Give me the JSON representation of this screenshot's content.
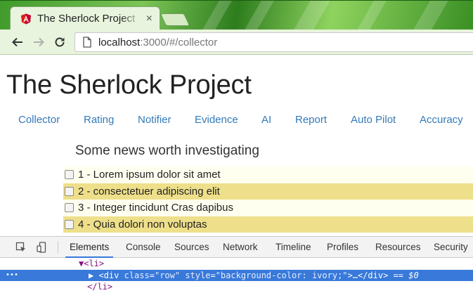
{
  "browser": {
    "tab_title": "The Sherlock Project",
    "tab_close": "×",
    "url_host": "localhost",
    "url_rest": ":3000/#/collector",
    "tab_icon": "angular-icon",
    "colors": {
      "theme_green": "#6bbf45",
      "toolbar": "#e8f4dd"
    }
  },
  "page": {
    "title": "The Sherlock Project",
    "nav": [
      "Collector",
      "Rating",
      "Notifier",
      "Evidence",
      "AI",
      "Report",
      "Auto Pilot",
      "Accuracy"
    ],
    "heading": "Some news worth investigating",
    "news": [
      {
        "text": "1 - Lorem ipsum dolor sit amet",
        "bg": "ivory"
      },
      {
        "text": "2 - consectetuer adipiscing elit",
        "bg": "gold"
      },
      {
        "text": "3 - Integer tincidunt Cras dapibus",
        "bg": "ivory"
      },
      {
        "text": "4 - Quia dolori non voluptas",
        "bg": "gold"
      }
    ],
    "colors": {
      "link": "#337ab7",
      "ivory": "#fffff0",
      "gold": "#eedf8a"
    }
  },
  "devtools": {
    "tabs": [
      "Elements",
      "Console",
      "Sources",
      "Network",
      "Timeline",
      "Profiles",
      "Resources",
      "Security"
    ],
    "active_tab": "Elements",
    "dom_lines": {
      "li_open": "▼<li>",
      "selected_dots": "•••",
      "div_arrow": "▶",
      "div_tag_open": "<div",
      "class_attr": "class",
      "class_val": "\"row\"",
      "style_attr": "style",
      "style_val": "\"background-color: ivory;\"",
      "div_rest": ">…</div>",
      "eq_ref": "== $0",
      "li_close": "</li>"
    },
    "colors": {
      "selection": "#3879d9"
    }
  }
}
